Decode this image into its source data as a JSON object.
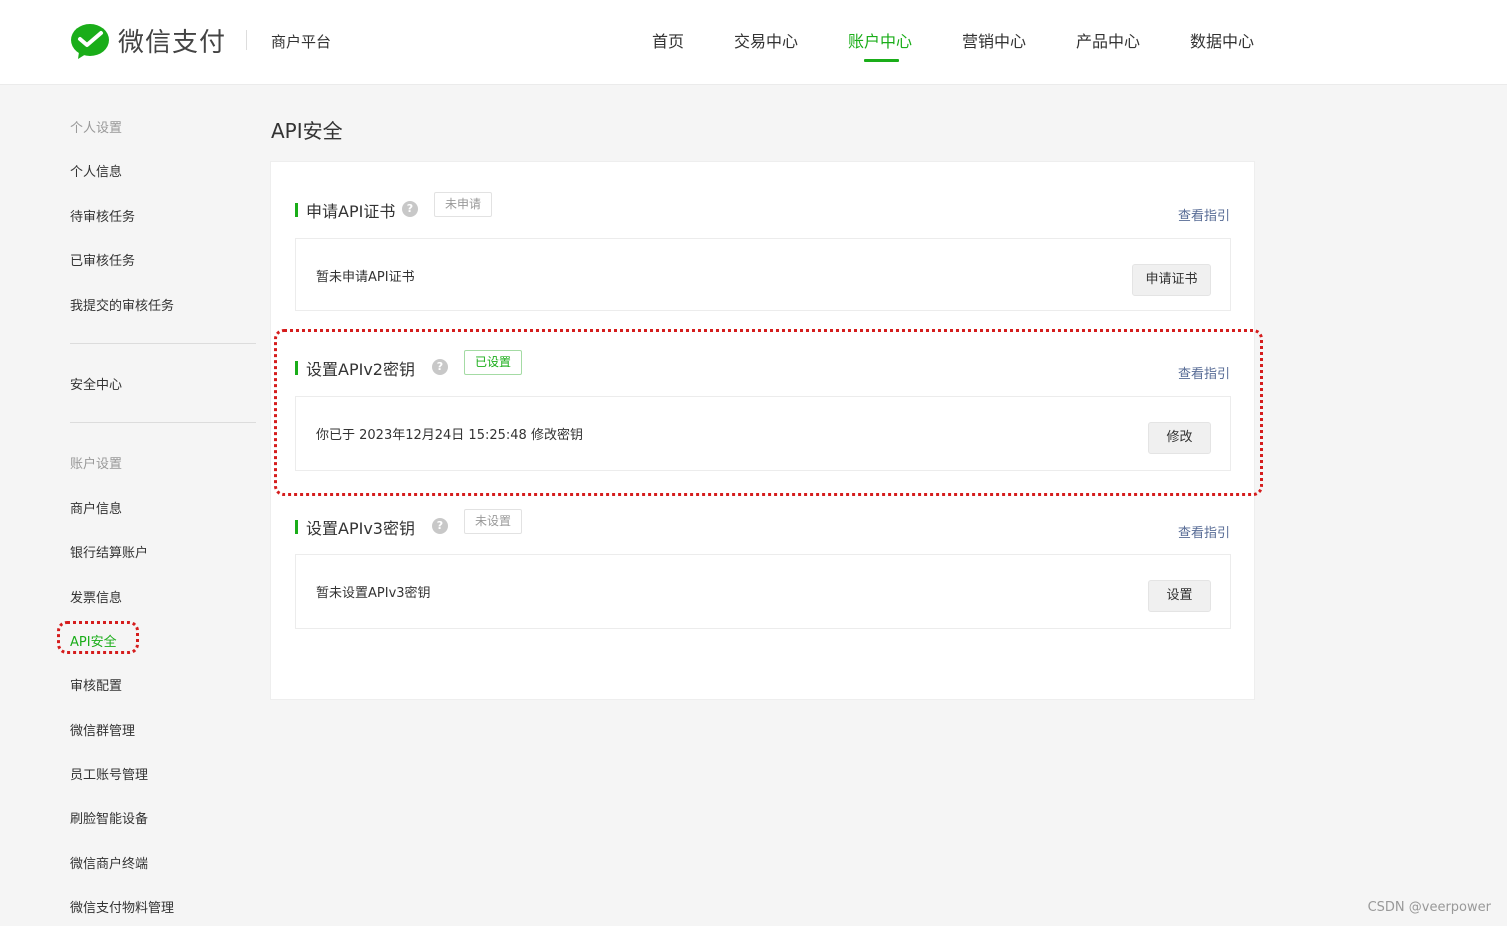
{
  "header": {
    "brand": "微信支付",
    "subbrand": "商户平台",
    "nav": [
      {
        "label": "首页",
        "active": false
      },
      {
        "label": "交易中心",
        "active": false
      },
      {
        "label": "账户中心",
        "active": true
      },
      {
        "label": "营销中心",
        "active": false
      },
      {
        "label": "产品中心",
        "active": false
      },
      {
        "label": "数据中心",
        "active": false
      }
    ],
    "logo_icon": "wechat-pay-logo-icon"
  },
  "sidebar": {
    "group_personal": "个人设置",
    "personal_items": [
      "个人信息",
      "待审核任务",
      "已审核任务",
      "我提交的审核任务"
    ],
    "security_center": "安全中心",
    "group_account": "账户设置",
    "account_items": [
      "商户信息",
      "银行结算账户",
      "发票信息",
      "API安全",
      "审核配置",
      "微信群管理",
      "员工账号管理",
      "刷脸智能设备",
      "微信商户终端",
      "微信支付物料管理"
    ],
    "active_item": "API安全"
  },
  "main": {
    "title": "API安全",
    "sections": [
      {
        "title": "申请API证书",
        "status": "未申请",
        "status_ok": false,
        "guide": "查看指引",
        "content": "暂未申请API证书",
        "button": "申请证书"
      },
      {
        "title": "设置APIv2密钥",
        "status": "已设置",
        "status_ok": true,
        "guide": "查看指引",
        "content": "你已于 2023年12月24日 15:25:48 修改密钥",
        "button": "修改"
      },
      {
        "title": "设置APIv3密钥",
        "status": "未设置",
        "status_ok": false,
        "guide": "查看指引",
        "content": "暂未设置APIv3密钥",
        "button": "设置"
      }
    ]
  },
  "colors": {
    "accent": "#1aad19",
    "link": "#576b95",
    "annotation": "#d51d1d"
  },
  "watermark": "CSDN @veerpower"
}
